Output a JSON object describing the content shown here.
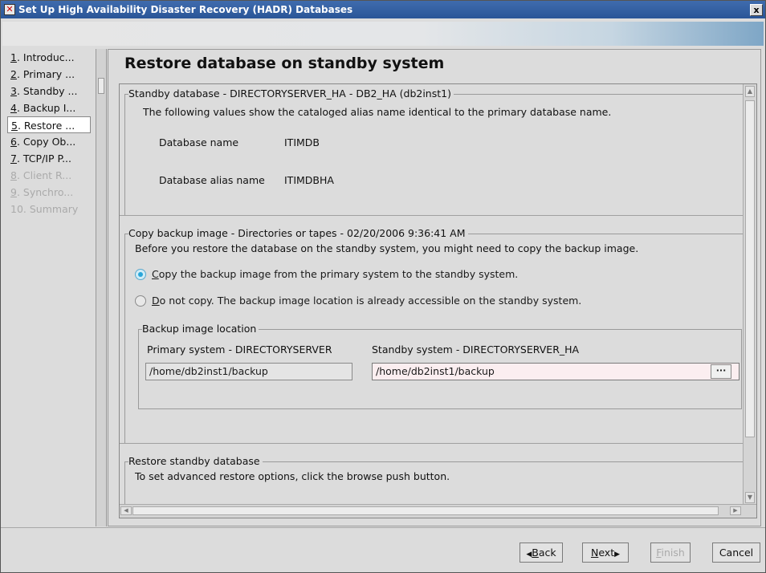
{
  "window": {
    "title": "Set Up High Availability Disaster Recovery (HADR) Databases",
    "close_glyph": "x"
  },
  "nav": {
    "items": [
      {
        "num": "1",
        "label": ". Introduc...",
        "state": "normal"
      },
      {
        "num": "2",
        "label": ". Primary ...",
        "state": "normal"
      },
      {
        "num": "3",
        "label": ". Standby ...",
        "state": "normal"
      },
      {
        "num": "4",
        "label": ". Backup I...",
        "state": "normal"
      },
      {
        "num": "5",
        "label": ". Restore ...",
        "state": "selected"
      },
      {
        "num": "6",
        "label": ". Copy Ob...",
        "state": "normal"
      },
      {
        "num": "7",
        "label": ". TCP/IP P...",
        "state": "normal"
      },
      {
        "num": "8",
        "label": ". Client R...",
        "state": "disabled"
      },
      {
        "num": "9",
        "label": ". Synchro...",
        "state": "disabled"
      },
      {
        "num": "",
        "label": "10. Summary",
        "state": "disabled"
      }
    ]
  },
  "page": {
    "title": "Restore database on standby system"
  },
  "standby_section": {
    "legend": "Standby database - DIRECTORYSERVER_HA - DB2_HA (db2inst1)",
    "description": "The following values show the cataloged alias name identical to the primary database name.",
    "db_name_label": "Database name",
    "db_name_value": "ITIMDB",
    "alias_label": "Database alias name",
    "alias_value": "ITIMDBHA"
  },
  "copy_section": {
    "legend": "Copy backup image - Directories or tapes - 02/20/2006 9:36:41 AM",
    "description": "Before you restore the database on the standby system, you might need to copy the backup image.",
    "option_copy_mnemonic": "C",
    "option_copy_rest": "opy the backup image from the primary system to the standby system.",
    "option_copy_selected": true,
    "option_nocopy_mnemonic": "D",
    "option_nocopy_rest": "o not copy. The backup image location is already accessible on the standby system.",
    "location_group": {
      "legend": "Backup image location",
      "primary_label": "Primary system - DIRECTORYSERVER",
      "primary_value": "/home/db2inst1/backup",
      "standby_label": "Standby system - DIRECTORYSERVER_HA",
      "standby_value": "/home/db2inst1/backup",
      "browse_label": "···"
    }
  },
  "restore_section": {
    "legend": "Restore standby database",
    "description": "To set advanced restore options, click the browse push button."
  },
  "footer": {
    "back_arrow": "◀",
    "back_mnemonic": "B",
    "back_rest": "ack",
    "next_mnemonic": "N",
    "next_rest": "ext",
    "next_arrow": "▶",
    "finish_mnemonic": "F",
    "finish_rest": "inish",
    "cancel_label": "Cancel"
  },
  "colors": {
    "titlebar": "#2a5597",
    "radio_selected": "#29a6d9",
    "editable_field": "#fbeef0"
  }
}
